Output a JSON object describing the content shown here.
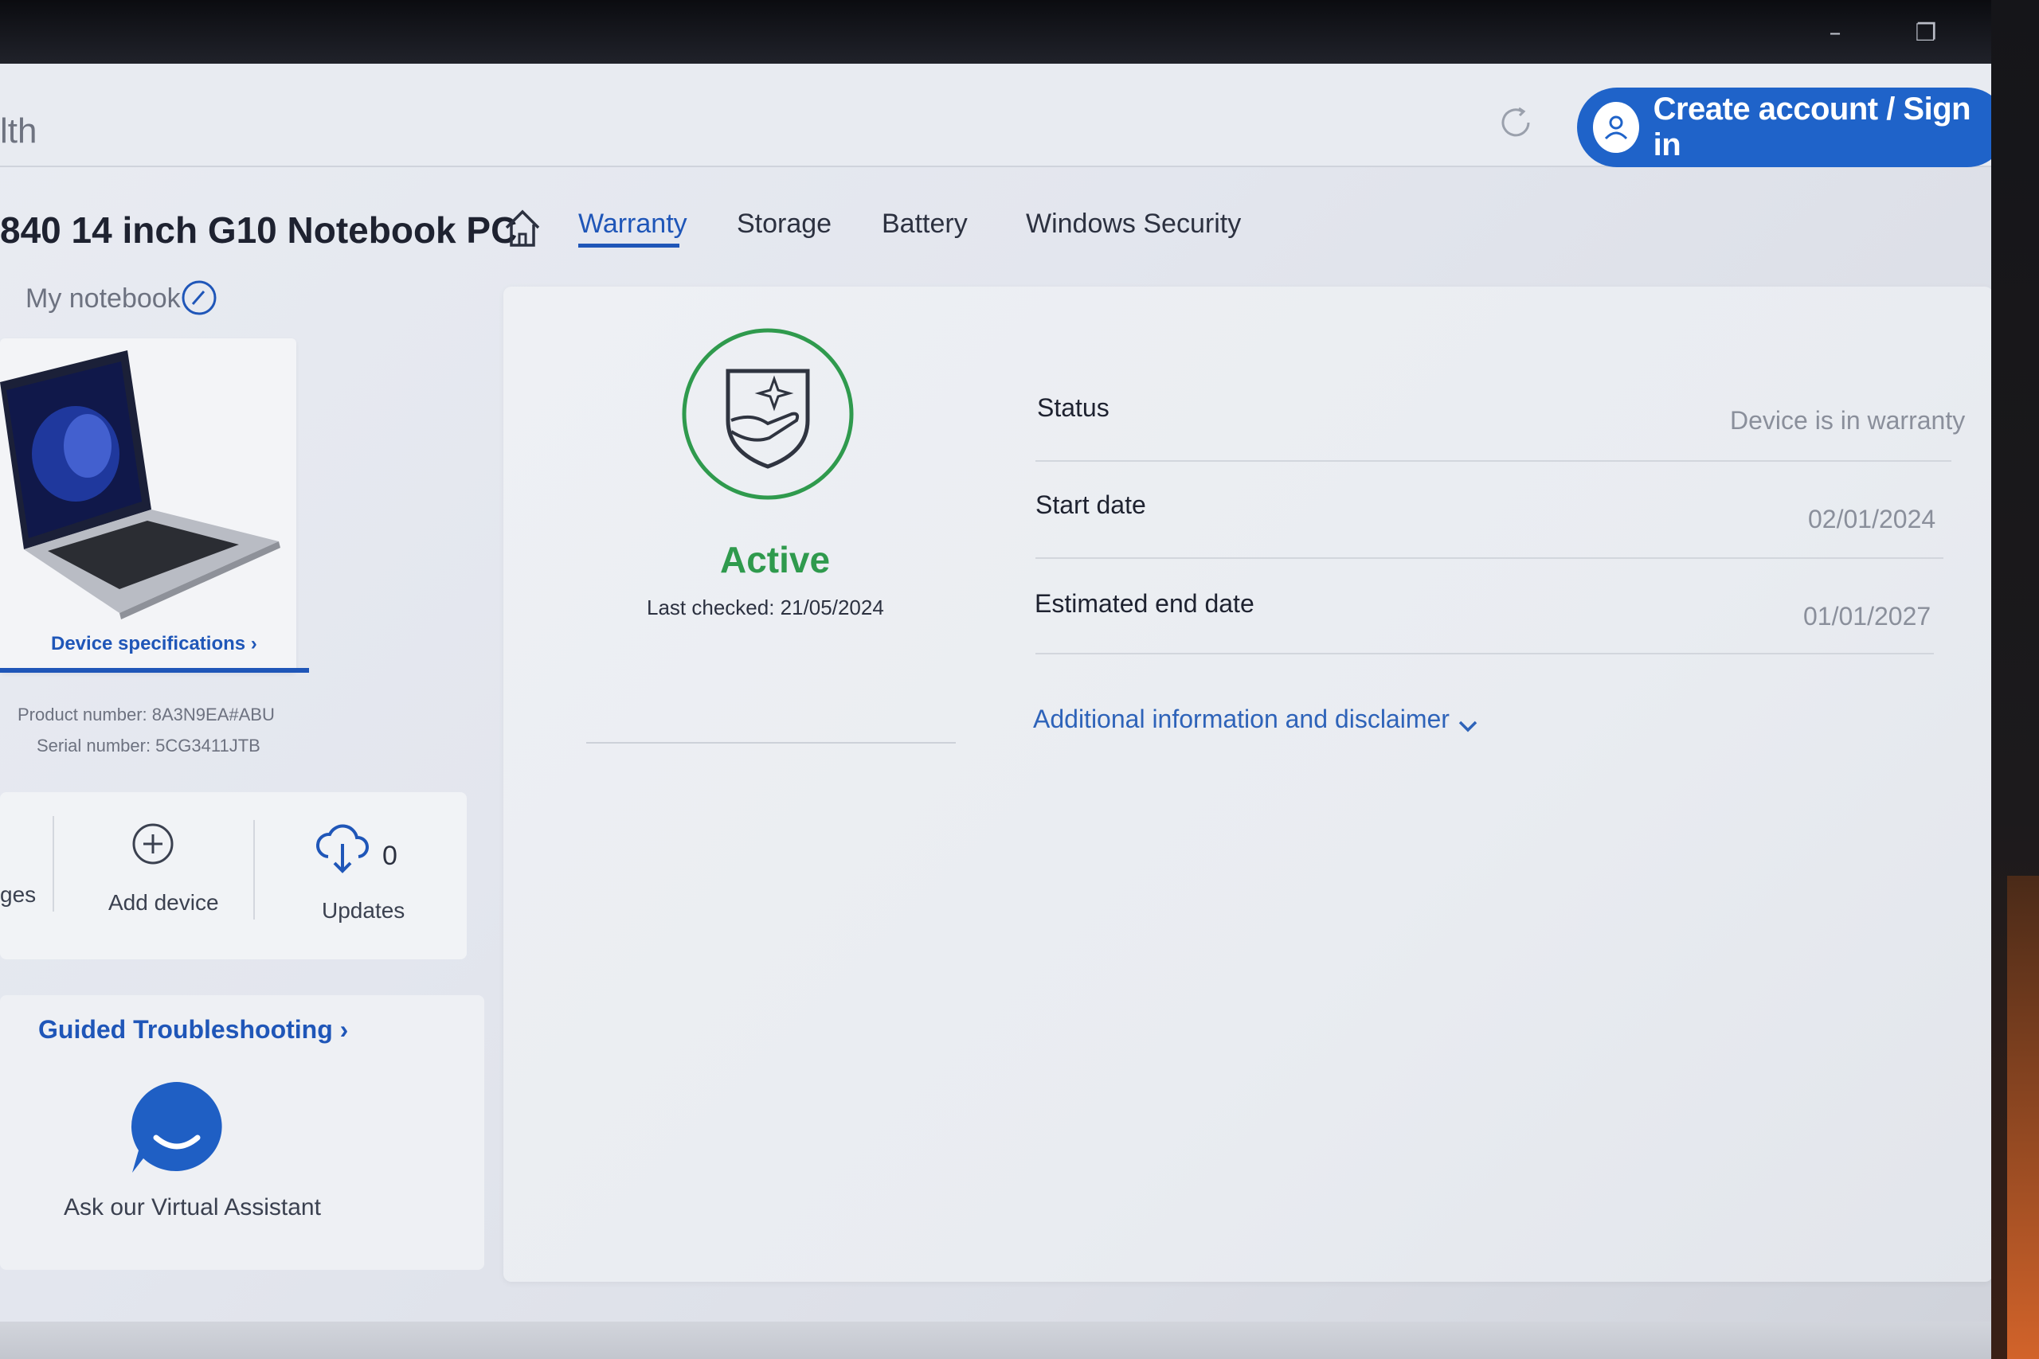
{
  "app": {
    "title": "lth"
  },
  "header": {
    "account_button_label": "Create account / Sign in"
  },
  "device": {
    "name": "840 14 inch G10 Notebook PC",
    "nickname": "My notebook",
    "spec_link": "Device specifications ›",
    "product_number": "Product number: 8A3N9EA#ABU",
    "serial_number": "Serial number: 5CG3411JTB"
  },
  "tabs": [
    {
      "label": "Warranty",
      "active": true
    },
    {
      "label": "Storage",
      "active": false
    },
    {
      "label": "Battery",
      "active": false
    },
    {
      "label": "Windows Security",
      "active": false
    }
  ],
  "actions": {
    "partial_label": "ges",
    "add_device": "Add device",
    "updates_label": "Updates",
    "updates_count": "0"
  },
  "troubleshooting": {
    "link": "Guided Troubleshooting ›",
    "assistant": "Ask our Virtual Assistant"
  },
  "warranty": {
    "status_badge": "Active",
    "last_checked": "Last checked: 21/05/2024",
    "rows": [
      {
        "label": "Status",
        "value": "Device is in warranty"
      },
      {
        "label": "Start date",
        "value": "02/01/2024"
      },
      {
        "label": "Estimated end date",
        "value": "01/01/2027"
      }
    ],
    "disclaimer": "Additional information and disclaimer"
  },
  "colors": {
    "accent": "#1f56b8",
    "account_button": "#1f63c9",
    "active_green": "#2f9a4d"
  }
}
